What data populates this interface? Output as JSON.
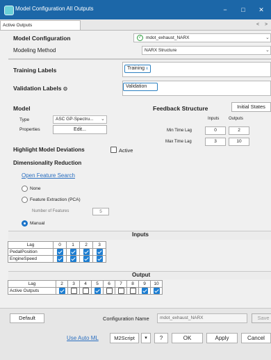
{
  "window": {
    "title": "Model Configuration All Outputs",
    "minimize": "−",
    "maximize": "□",
    "close": "✕"
  },
  "tabs": {
    "active": "Active Outputs",
    "prev": "<",
    "next": ">"
  },
  "model_config": {
    "label": "Model Configuration",
    "value": "mdot_exhaust_NARX",
    "status_icon": "check-circle-icon"
  },
  "modeling_method": {
    "label": "Modeling Method",
    "value": "NARX Structure"
  },
  "training": {
    "label": "Training Labels",
    "chip": "Training",
    "chip_close": "x"
  },
  "validation": {
    "label": "Validation Labels",
    "info": "⊙",
    "chip": "Validation"
  },
  "model": {
    "header": "Model",
    "type_label": "Type",
    "type_value": "ASC GP-Spectru...",
    "properties_label": "Properties",
    "edit_button": "Edit..."
  },
  "feedback": {
    "header": "Feedback Structure",
    "initial_states": "Initial States",
    "inputs_col": "Inputs",
    "outputs_col": "Outputs",
    "min_label": "Min Time Lag",
    "min_inputs": "0",
    "min_outputs": "2",
    "max_label": "Max Time Lag",
    "max_inputs": "3",
    "max_outputs": "10"
  },
  "highlight": {
    "label": "Highlight Model Deviations",
    "active_label": "Active",
    "active_checked": false
  },
  "dim_reduction": {
    "header": "Dimensionality Reduction",
    "search_link": "Open Feature Search",
    "options": [
      {
        "label": "None",
        "selected": false
      },
      {
        "label": "Feature Extraction (PCA)",
        "selected": false
      },
      {
        "label": "Manual",
        "selected": true
      }
    ],
    "num_features_label": "Number of Features",
    "num_features": "5"
  },
  "inputs_table": {
    "title": "Inputs",
    "header": [
      "Lag",
      "0",
      "1",
      "2",
      "3"
    ],
    "rows": [
      {
        "name": "PedalPosition",
        "checks": [
          true,
          true,
          true,
          true
        ]
      },
      {
        "name": "EngineSpeed",
        "checks": [
          true,
          true,
          true,
          true
        ]
      }
    ]
  },
  "output_table": {
    "title": "Output",
    "header": [
      "Lag",
      "2",
      "3",
      "4",
      "5",
      "6",
      "7",
      "8",
      "9",
      "10"
    ],
    "rows": [
      {
        "name": "Active Outputs",
        "checks": [
          true,
          false,
          false,
          true,
          false,
          false,
          false,
          true,
          true
        ]
      }
    ]
  },
  "footer": {
    "default_button": "Default",
    "config_name_label": "Configuration Name",
    "config_name_value": "mdot_exhaust_NARX",
    "save_button": "Save",
    "auto_ml_link": "Use Auto ML",
    "m2script_button": "M2Script",
    "m2script_menu": "▾",
    "help_button": "?",
    "ok_button": "OK",
    "apply_button": "Apply",
    "cancel_button": "Cancel"
  },
  "colors": {
    "titlebar": "#1c67a8",
    "accent": "#1d7ed2",
    "link": "#2a6fc0",
    "status_ok": "#2e9e3e"
  }
}
